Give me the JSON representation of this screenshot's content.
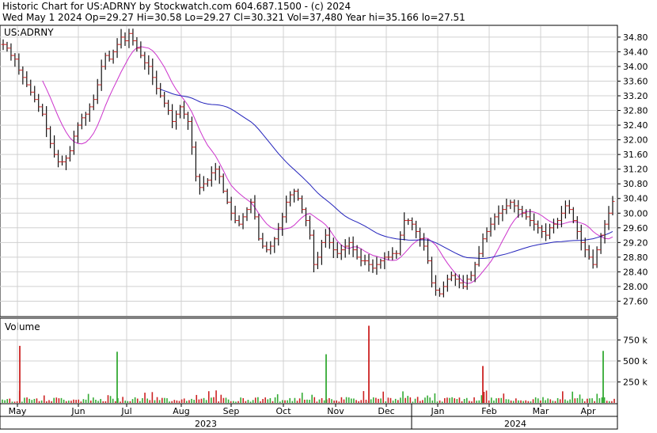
{
  "header": {
    "title": "Historic Chart for US:ADRNY by Stockwatch.com 604.687.1500 - (c) 2024",
    "summary": "Wed May  1 2024   Op=29.27   Hi=30.58   Lo=29.27   Cl=30.321   Vol=37,480   Year hi=35.166   lo=27.51"
  },
  "chart_data": [
    {
      "type": "bar",
      "subtype": "ohlc",
      "symbol_label": "US:ADRNY",
      "ylim": [
        27.2,
        35.1
      ],
      "y_ticks": [
        "34.80",
        "34.40",
        "34.00",
        "33.60",
        "33.20",
        "32.80",
        "32.40",
        "32.00",
        "31.60",
        "31.20",
        "30.80",
        "30.40",
        "30.00",
        "29.60",
        "29.20",
        "28.80",
        "28.40",
        "28.00",
        "27.60"
      ],
      "x_ticks": [
        "May",
        "Jun",
        "Jul",
        "Aug",
        "Sep",
        "Oct",
        "Nov",
        "Dec",
        "Jan",
        "Feb",
        "Mar",
        "Apr"
      ],
      "years": [
        "2023",
        "2024"
      ],
      "last": {
        "date": "2024-05-01",
        "open": 29.27,
        "high": 30.58,
        "low": 29.27,
        "close": 30.321
      },
      "year_high": 35.166,
      "year_low": 27.51,
      "closes": [
        34.6,
        34.5,
        34.3,
        34.2,
        33.9,
        33.7,
        33.5,
        33.3,
        33.1,
        32.9,
        32.7,
        32.3,
        31.9,
        31.6,
        31.4,
        31.4,
        31.5,
        31.7,
        32.1,
        32.4,
        32.6,
        32.7,
        32.9,
        33.1,
        33.5,
        34.0,
        34.3,
        34.2,
        34.4,
        34.6,
        34.8,
        34.7,
        34.9,
        34.7,
        34.5,
        34.3,
        34.1,
        34.0,
        33.7,
        33.4,
        33.2,
        33.0,
        32.8,
        32.5,
        32.7,
        32.9,
        32.7,
        32.5,
        31.8,
        31.0,
        30.7,
        30.8,
        30.9,
        31.1,
        31.2,
        31.0,
        30.6,
        30.3,
        30.0,
        29.8,
        29.7,
        29.9,
        30.1,
        30.3,
        29.9,
        29.3,
        29.1,
        29.0,
        29.1,
        29.3,
        29.6,
        29.9,
        30.3,
        30.5,
        30.6,
        30.4,
        30.1,
        29.8,
        29.4,
        28.6,
        28.8,
        29.2,
        29.4,
        29.2,
        29.0,
        28.9,
        29.0,
        29.1,
        29.2,
        29.0,
        28.8,
        28.7,
        28.7,
        28.6,
        28.5,
        28.6,
        28.7,
        28.8,
        28.8,
        28.9,
        28.9,
        29.4,
        29.8,
        29.8,
        29.7,
        29.5,
        29.3,
        29.1,
        28.7,
        28.1,
        27.9,
        27.8,
        28.0,
        28.2,
        28.3,
        28.2,
        28.1,
        28.0,
        28.2,
        28.3,
        28.6,
        28.9,
        29.3,
        29.5,
        29.7,
        29.9,
        30.0,
        30.1,
        30.2,
        30.3,
        30.2,
        30.1,
        30.0,
        29.9,
        29.8,
        29.7,
        29.6,
        29.5,
        29.4,
        29.6,
        29.7,
        29.8,
        30.0,
        30.2,
        30.1,
        29.8,
        29.5,
        29.2,
        29.0,
        28.8,
        28.6,
        29.0,
        29.4,
        29.7,
        30.0,
        30.321
      ],
      "series": [
        {
          "name": "",
          "color": "#cc33cc",
          "kind": "short moving average"
        },
        {
          "name": "",
          "color": "#2222bb",
          "kind": "long moving average"
        }
      ],
      "colors": {
        "bar": "#111111",
        "tick": "#cc2222",
        "grid": "#d0d0d0"
      }
    },
    {
      "type": "bar",
      "title": "Volume",
      "y_ticks": [
        "750 k",
        "500 k",
        "250 k"
      ],
      "ylim": [
        0,
        1000
      ],
      "unit": "thousand shares",
      "up_color": "#33aa33",
      "down_color": "#cc2222",
      "spikes": [
        {
          "month": "May",
          "value": 680,
          "color": "red"
        },
        {
          "month": "Jul",
          "value": 610,
          "color": "green"
        },
        {
          "month": "Nov",
          "value": 580,
          "color": "green"
        },
        {
          "month": "Dec",
          "value": 920,
          "color": "red"
        },
        {
          "month": "Jan",
          "value": 440,
          "color": "red"
        },
        {
          "month": "Apr",
          "value": 620,
          "color": "green"
        }
      ]
    }
  ]
}
